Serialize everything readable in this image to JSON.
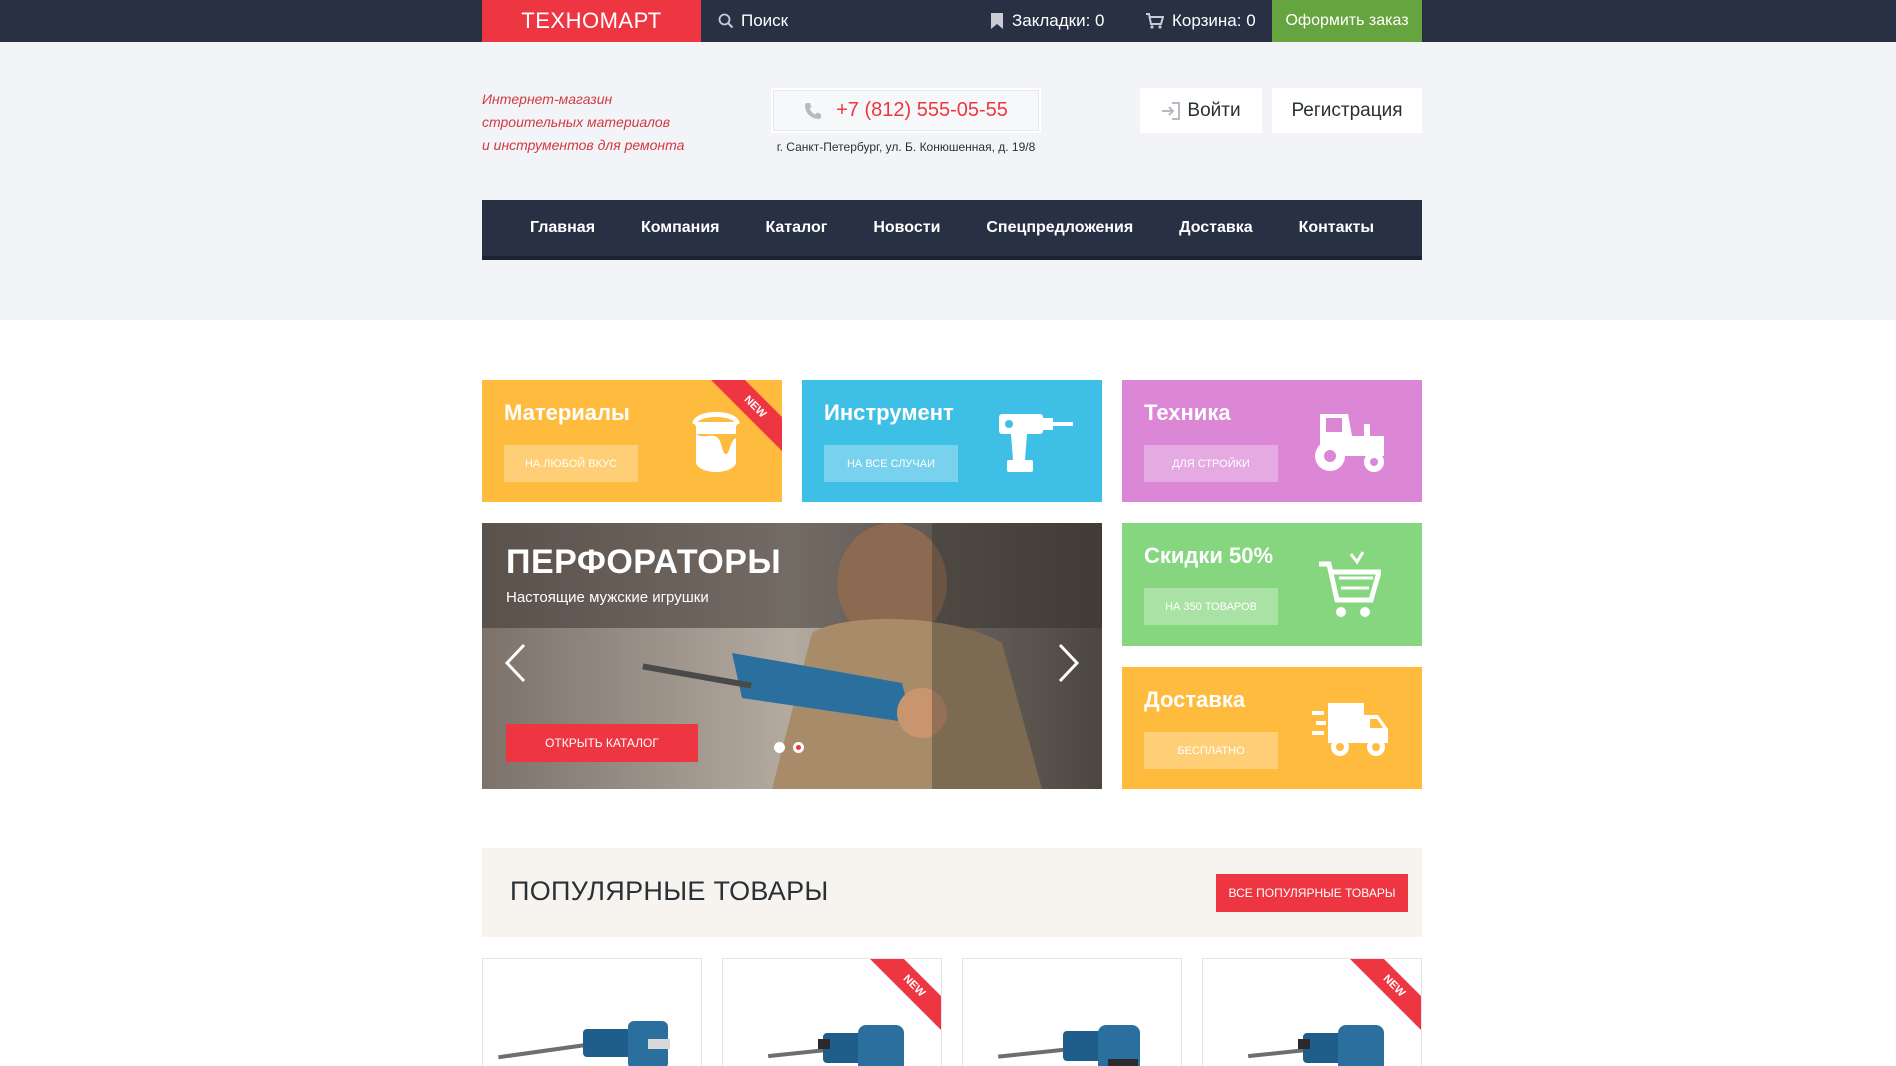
{
  "topbar": {
    "logo": "ТЕХНОМАРТ",
    "search_label": "Поиск",
    "bookmarks_label": "Закладки: 0",
    "cart_label": "Корзина: 0",
    "order_button": "Оформить заказ"
  },
  "header": {
    "tagline_1": "Интернет-магазин",
    "tagline_2": "строительных материалов",
    "tagline_3": "и инструментов для ремонта",
    "phone": "+7 (812) 555-05-55",
    "address": "г. Санкт-Петербург, ул. Б. Конюшенная, д. 19/8",
    "login": "Войти",
    "register": "Регистрация"
  },
  "nav": {
    "items": [
      "Главная",
      "Компания",
      "Каталог",
      "Новости",
      "Спецпредложения",
      "Доставка",
      "Контакты"
    ]
  },
  "tiles": {
    "materials": {
      "title": "Материалы",
      "button": "НА ЛЮБОЙ ВКУС",
      "ribbon": "NEW",
      "icon": "paint-bucket-icon"
    },
    "tools": {
      "title": "Инструмент",
      "button": "НА ВСЕ СЛУЧАИ",
      "icon": "drill-icon"
    },
    "machines": {
      "title": "Техника",
      "button": "ДЛЯ СТРОЙКИ",
      "icon": "tractor-icon"
    },
    "sales": {
      "title": "Скидки 50%",
      "button": "НА 350 ТОВАРОВ",
      "icon": "shopping-cart-icon"
    },
    "delivery": {
      "title": "Доставка",
      "button": "БЕСПЛАТНО",
      "icon": "delivery-truck-icon"
    }
  },
  "slider": {
    "title": "ПЕРФОРАТОРЫ",
    "subtitle": "Настоящие мужские игрушки",
    "button": "ОТКРЫТЬ КАТАЛОГ",
    "slides_count": 2,
    "active_slide": 2
  },
  "popular": {
    "title": "ПОПУЛЯРНЫЕ ТОВАРЫ",
    "button": "ВСЕ ПОПУЛЯРНЫЕ ТОВАРЫ",
    "ribbon": "NEW"
  },
  "colors": {
    "accent_red": "#ee3643",
    "dark_navy": "#283044",
    "green": "#66a43f",
    "tile_yellow": "#ffbb3d",
    "tile_blue": "#3ebfe6",
    "tile_pink": "#dc86d6",
    "tile_green": "#86d67f"
  }
}
